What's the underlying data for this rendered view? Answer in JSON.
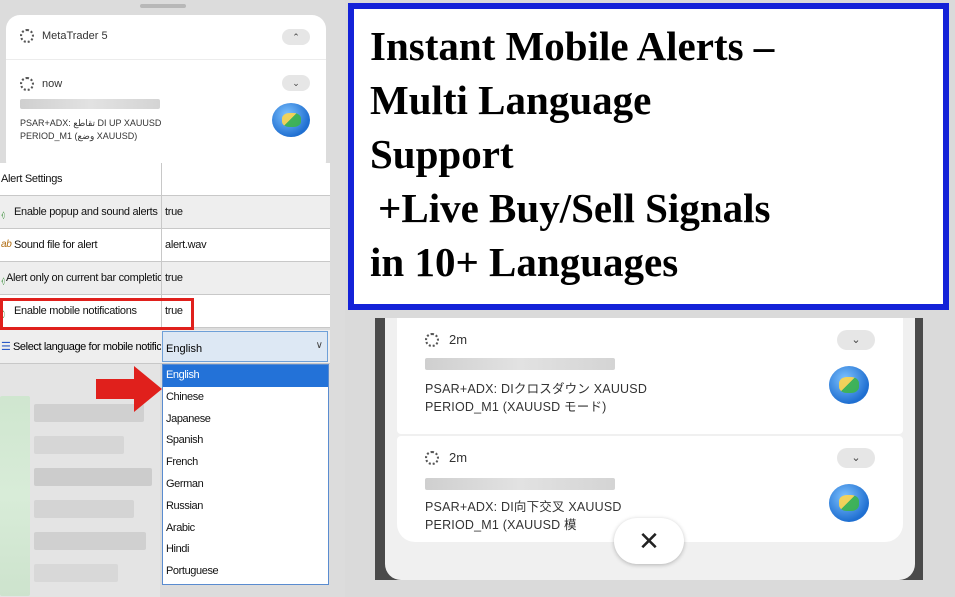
{
  "left_panel": {
    "app_notification": {
      "app_name": "MetaTrader 5",
      "collapse_glyph": "⌃",
      "time": "now",
      "expand_glyph": "⌄",
      "message_line1": "PSAR+ADX: تقاطع DI UP XAUUSD",
      "message_line2": "PERIOD_M1 (وضع XAUUSD)"
    },
    "settings": {
      "header": "Alert Settings",
      "rows": [
        {
          "label": "Enable popup and sound alerts",
          "value": "true",
          "icon": "tree-icon"
        },
        {
          "label": "Sound file for alert",
          "value": "alert.wav",
          "icon": "ab-icon"
        },
        {
          "label": "Alert only on current bar completion",
          "value": "true",
          "icon": "tree-icon"
        },
        {
          "label": "Enable mobile notifications",
          "value": "true",
          "icon": "tree-icon"
        }
      ],
      "language_row": {
        "label": "Select language for mobile notifications",
        "value": "English",
        "chevron": "∨"
      },
      "language_options": [
        "English",
        "Chinese",
        "Japanese",
        "Spanish",
        "French",
        "German",
        "Russian",
        "Arabic",
        "Hindi",
        "Portuguese"
      ],
      "selected_option": "English"
    },
    "colors": {
      "highlight_border": "#e0201c",
      "arrow": "#e0201c",
      "selection": "#2372d8"
    }
  },
  "right_panel": {
    "headline": {
      "line1": "Instant  Mobile  Alerts –",
      "line2": "Multi Language",
      "line3": "Support",
      "line4": "+Live Buy/Sell Signals",
      "line5": "in 10+ Languages"
    },
    "notifications": [
      {
        "time": "2m",
        "expand_glyph": "⌄",
        "line1": "PSAR+ADX: DIクロスダウン XAUUSD",
        "line2": "PERIOD_M1 (XAUUSD モード)"
      },
      {
        "time": "2m",
        "expand_glyph": "⌄",
        "line1": "PSAR+ADX: DI向下交叉 XAUUSD",
        "line2": "PERIOD_M1 (XAUUSD 模"
      }
    ],
    "close_glyph": "✕",
    "colors": {
      "headline_border": "#1422d8"
    }
  }
}
